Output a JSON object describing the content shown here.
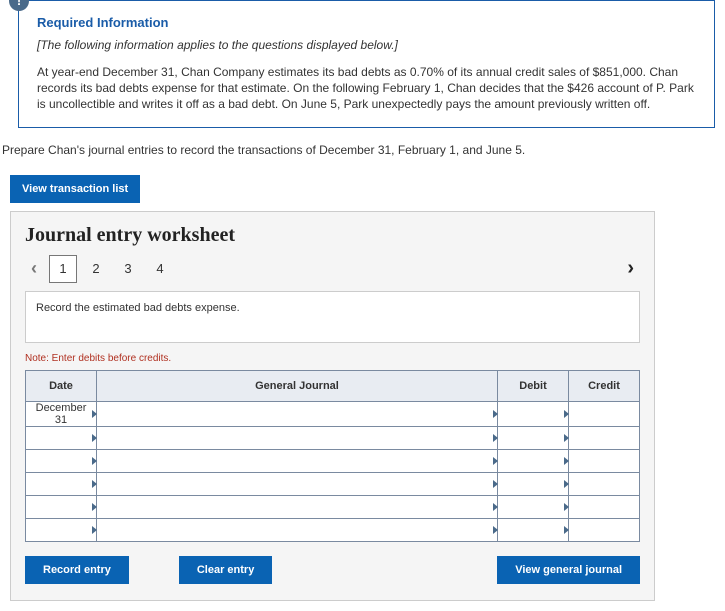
{
  "info": {
    "badge": "!",
    "title": "Required Information",
    "subtitle": "[The following information applies to the questions displayed below.]",
    "body": "At year-end December 31, Chan Company estimates its bad debts as 0.70% of its annual credit sales of $851,000. Chan records its bad debts expense for that estimate. On the following February 1, Chan decides that the $426 account of P. Park is uncollectible and writes it off as a bad debt. On June 5, Park unexpectedly pays the amount previously written off."
  },
  "prepare": "Prepare Chan's journal entries to record the transactions of December 31, February 1, and June 5.",
  "view_list_btn": "View transaction list",
  "worksheet": {
    "title": "Journal entry worksheet",
    "tabs": [
      "1",
      "2",
      "3",
      "4"
    ],
    "active_tab": 0,
    "instruction": "Record the estimated bad debts expense.",
    "note": "Note: Enter debits before credits.",
    "headers": {
      "date": "Date",
      "gj": "General Journal",
      "debit": "Debit",
      "credit": "Credit"
    },
    "rows": [
      {
        "date": "December 31",
        "gj": "",
        "debit": "",
        "credit": ""
      },
      {
        "date": "",
        "gj": "",
        "debit": "",
        "credit": ""
      },
      {
        "date": "",
        "gj": "",
        "debit": "",
        "credit": ""
      },
      {
        "date": "",
        "gj": "",
        "debit": "",
        "credit": ""
      },
      {
        "date": "",
        "gj": "",
        "debit": "",
        "credit": ""
      },
      {
        "date": "",
        "gj": "",
        "debit": "",
        "credit": ""
      }
    ],
    "buttons": {
      "record": "Record entry",
      "clear": "Clear entry",
      "view_gj": "View general journal"
    }
  }
}
